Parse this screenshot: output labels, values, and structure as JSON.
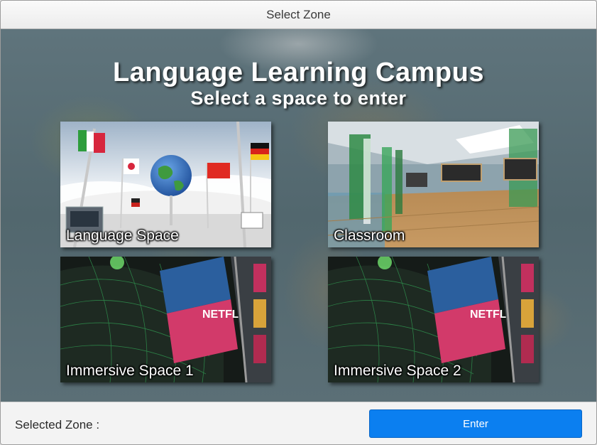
{
  "window": {
    "title": "Select Zone"
  },
  "main": {
    "heading": "Language Learning Campus",
    "subheading": "Select a space to enter",
    "tiles": [
      {
        "label": "Language Space"
      },
      {
        "label": "Classroom"
      },
      {
        "label": "Immersive Space 1"
      },
      {
        "label": "Immersive Space 2"
      }
    ]
  },
  "footer": {
    "selected_label": "Selected Zone :",
    "enter_label": "Enter"
  },
  "colors": {
    "accent": "#0b7ff0",
    "title_text": "#3a3a3a"
  }
}
